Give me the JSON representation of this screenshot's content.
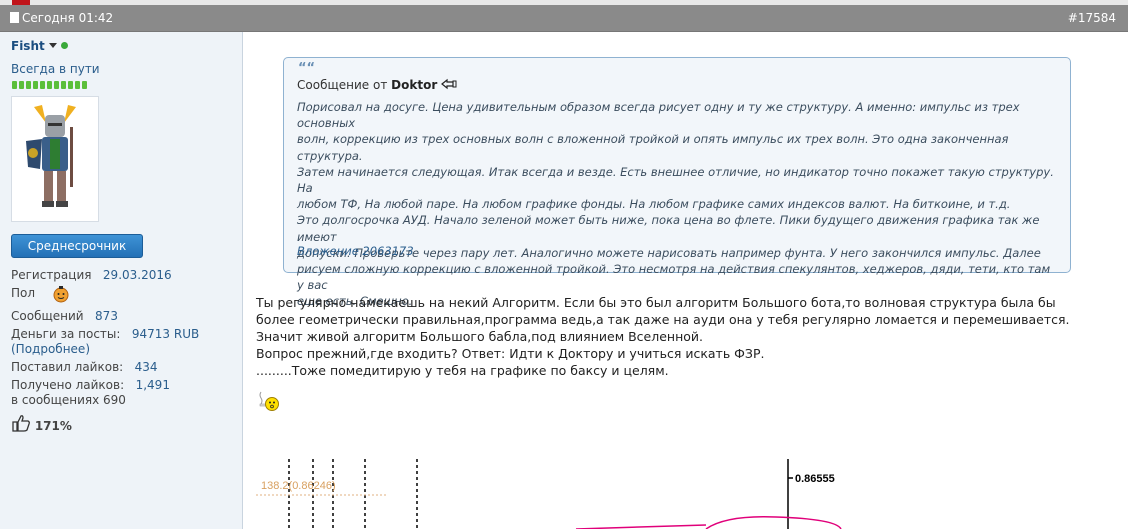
{
  "header": {
    "date": "Сегодня 01:42",
    "post_number": "#17584"
  },
  "user": {
    "name": "Fisht",
    "title": "Всегда в пути",
    "rank_badge": "Среднесрочник",
    "stats": {
      "reg_label": "Регистрация",
      "reg_value": "29.03.2016",
      "gender_label": "Пол",
      "posts_label": "Сообщений",
      "posts_value": "873",
      "money_label": "Деньги за посты:",
      "money_value": "94713 RUB",
      "money_link": "(Подробнее)",
      "likes_given_label": "Поставил лайков:",
      "likes_given_value": "434",
      "likes_recv_label": "Получено лайков:",
      "likes_recv_value": "1,491",
      "likes_recv_line2": "в сообщениях 690",
      "rating": "171%"
    }
  },
  "quote": {
    "mark": "““",
    "from_prefix": "Сообщение от",
    "author": "Doktor",
    "lines": [
      "Порисовал на досуге. Цена удивительным образом всегда рисует одну и ту же структуру. А именно: импульс из трех основных",
      "волн, коррекцию из трех основных волн с вложенной тройкой и опять импульс их трех волн. Это одна законченная структура.",
      "Затем начинается следующая. Итак всегда и везде. Есть внешнее отличие, но индикатор точно покажет такую структуру. На",
      "любом ТФ, На любой паре. На любом графике фонды. На любом графике самих индексов валют. На биткоине, и т.д.",
      "Это долгосрочка АУД. Начало зеленой может быть ниже, пока цена во флете. Пики будущего движения графика так же имеют",
      "допуски. Проверьте через пару лет. Аналогично можете нарисовать например фунта. У него закончился импульс. Далее",
      "рисуем сложную коррекцию с вложенной тройкой. Это несмотря на действия спекулянтов, хеджеров, дяди, тети, кто там у вас",
      "еще есть. Смешно."
    ],
    "attachment": "Вложение 2063173"
  },
  "message": {
    "lines": [
      "Ты регулярно намекаешь на некий Алгоритм. Если бы это был алгоритм Большого бота,то волновая структура была бы",
      "более геометрически правильная,программа ведь,а так даже на ауди она у тебя регулярно ломается и перемешивается.",
      "Значит живой алгоритм Большого бабла,под влиянием Вселенной.",
      "Вопрос прежний,где входить? Ответ: Идти к Доктору и учиться искать ФЗР.",
      ".........Тоже помедитирую у тебя на графике по баксу и целям."
    ]
  },
  "chart_fragment": {
    "fib_label": "138.2(0.86246)",
    "price_label": "0.86555"
  },
  "colors": {
    "post_bar": "#8a8a8a",
    "sidebar_bg": "#eef3f8",
    "quote_bg": "#f2f6fa",
    "link": "#2a5d8c",
    "badge": "#2370b6"
  }
}
